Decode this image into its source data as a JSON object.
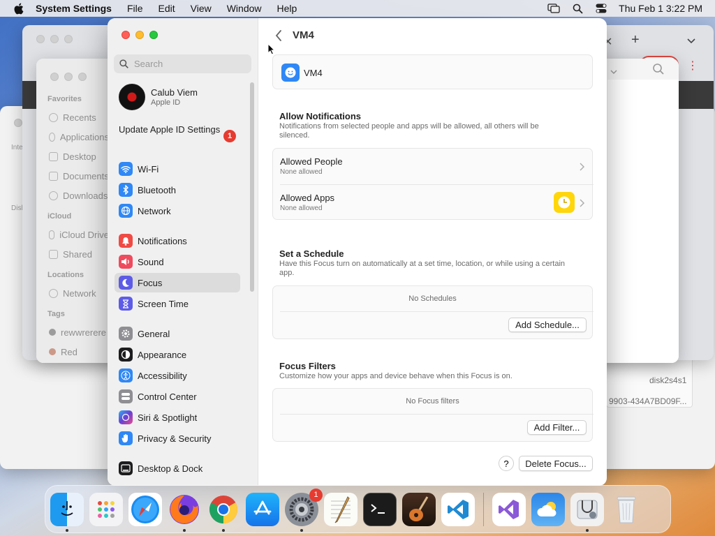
{
  "menubar": {
    "app": "System Settings",
    "items": [
      "File",
      "Edit",
      "View",
      "Window",
      "Help"
    ],
    "clock": "Thu Feb 1  3:22 PM",
    "icons": [
      "apple-logo-icon",
      "screen-mirroring-icon",
      "spotlight-search-icon",
      "control-center-icon"
    ]
  },
  "finder": {
    "sections": [
      {
        "header": "Favorites",
        "items": [
          "Recents",
          "Applications",
          "Desktop",
          "Documents",
          "Downloads"
        ]
      },
      {
        "header": "iCloud",
        "items": [
          "iCloud Drive",
          "Shared"
        ]
      },
      {
        "header": "Locations",
        "items": [
          "Network"
        ]
      },
      {
        "header": "Tags",
        "items": [
          "rewwrerere",
          "Red"
        ]
      }
    ]
  },
  "disk_utility": {
    "sidebar_labels": [
      "Intern",
      "Disk Ir"
    ],
    "right_texts": [
      "disk2s4s1",
      "9903-434A7BD09F..."
    ]
  },
  "settings": {
    "search_placeholder": "Search",
    "account": {
      "name": "Calub Viem",
      "sub": "Apple ID"
    },
    "update": {
      "label": "Update Apple ID Settings",
      "badge": "1"
    },
    "nav": [
      {
        "label": "Wi-Fi",
        "icon": "wifi-icon",
        "color": "#2f88f5"
      },
      {
        "label": "Bluetooth",
        "icon": "bluetooth-icon",
        "color": "#2f88f5"
      },
      {
        "label": "Network",
        "icon": "globe-icon",
        "color": "#2f88f5"
      },
      {
        "label": "Notifications",
        "icon": "bell-icon",
        "color": "#ef4b44"
      },
      {
        "label": "Sound",
        "icon": "speaker-icon",
        "color": "#ef4b5e"
      },
      {
        "label": "Focus",
        "icon": "moon-icon",
        "color": "#5e5ce6"
      },
      {
        "label": "Screen Time",
        "icon": "hourglass-icon",
        "color": "#5e5ce6"
      },
      {
        "label": "General",
        "icon": "gear-icon",
        "color": "#8e8e93"
      },
      {
        "label": "Appearance",
        "icon": "appearance-icon",
        "color": "#1c1c1e"
      },
      {
        "label": "Accessibility",
        "icon": "accessibility-icon",
        "color": "#2f88f5"
      },
      {
        "label": "Control Center",
        "icon": "control-center-icon",
        "color": "#8e8e93"
      },
      {
        "label": "Siri & Spotlight",
        "icon": "siri-icon",
        "color": "#6a3fd1"
      },
      {
        "label": "Privacy & Security",
        "icon": "hand-icon",
        "color": "#2f88f5"
      },
      {
        "label": "Desktop & Dock",
        "icon": "dock-icon",
        "color": "#1c1c1e"
      }
    ],
    "selected": "Focus",
    "content": {
      "title": "VM4",
      "focus_name": "VM4",
      "allow": {
        "title": "Allow Notifications",
        "desc": "Notifications from selected people and apps will be allowed, all others will be silenced.",
        "people": {
          "title": "Allowed People",
          "sub": "None allowed"
        },
        "apps": {
          "title": "Allowed Apps",
          "sub": "None allowed"
        }
      },
      "schedule": {
        "title": "Set a Schedule",
        "desc": "Have this Focus turn on automatically at a set time, location, or while using a certain app.",
        "empty": "No Schedules",
        "button": "Add Schedule..."
      },
      "filters": {
        "title": "Focus Filters",
        "desc": "Customize how your apps and device behave when this Focus is on.",
        "empty": "No Focus filters",
        "button": "Add Filter..."
      },
      "help": "?",
      "delete": "Delete Focus..."
    }
  },
  "dock": {
    "apps": [
      "Finder",
      "Launchpad",
      "Safari",
      "Firefox",
      "Google Chrome",
      "App Store",
      "System Settings",
      "TextEdit",
      "Terminal",
      "GarageBand",
      "Visual Studio Code",
      "Visual Studio",
      "Weather",
      "Disk Utility",
      "Trash"
    ],
    "system_settings_badge": "1"
  }
}
